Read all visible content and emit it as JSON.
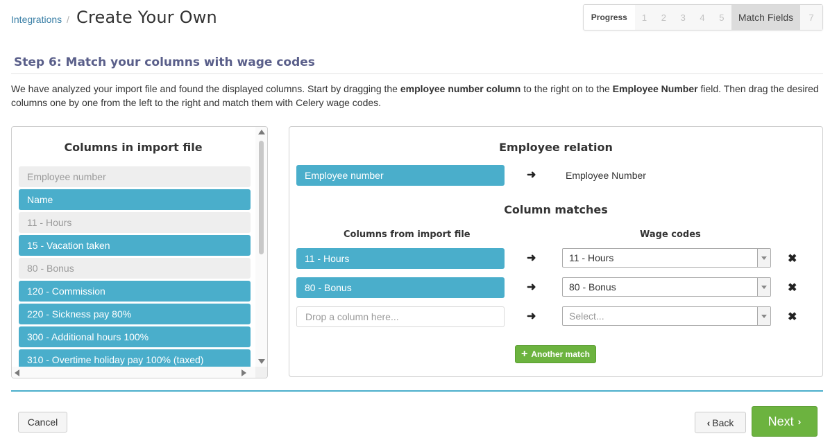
{
  "breadcrumb": {
    "parent": "Integrations",
    "separator": "/"
  },
  "page_title": "Create Your Own",
  "progress": {
    "label": "Progress",
    "steps": [
      "1",
      "2",
      "3",
      "4",
      "5"
    ],
    "active_label": "Match Fields",
    "last_step": "7"
  },
  "step_title": "Step 6: Match your columns with wage codes",
  "intro": {
    "part1": "We have analyzed your import file and found the displayed columns. Start by dragging the ",
    "bold1": "employee number column",
    "part2": " to the right on to the ",
    "bold2": "Employee Number",
    "part3": " field. Then drag the desired columns one by one from the left to the right and match them with Celery wage codes."
  },
  "left_panel": {
    "heading": "Columns in import file",
    "items": [
      {
        "label": "Employee number",
        "state": "used"
      },
      {
        "label": "Name",
        "state": "available"
      },
      {
        "label": "11 - Hours",
        "state": "used"
      },
      {
        "label": "15 - Vacation taken",
        "state": "available"
      },
      {
        "label": "80 - Bonus",
        "state": "used"
      },
      {
        "label": "120 - Commission",
        "state": "available"
      },
      {
        "label": "220 - Sickness pay 80%",
        "state": "available"
      },
      {
        "label": "300 - Additional hours 100%",
        "state": "available"
      },
      {
        "label": "310 - Overtime holiday pay 100% (taxed)",
        "state": "available"
      }
    ]
  },
  "right_panel": {
    "relation_heading": "Employee relation",
    "relation_column": "Employee number",
    "relation_target": "Employee Number",
    "matches_heading": "Column matches",
    "col_header_left": "Columns from import file",
    "col_header_right": "Wage codes",
    "matches": [
      {
        "column": "11 - Hours",
        "wage_code": "11 - Hours"
      },
      {
        "column": "80 - Bonus",
        "wage_code": "80 - Bonus"
      }
    ],
    "drop_placeholder": "Drop a column here...",
    "select_placeholder": "Select...",
    "add_button": "Another match"
  },
  "footer": {
    "cancel": "Cancel",
    "back": "Back",
    "next": "Next"
  },
  "colors": {
    "accent": "#4aaecb",
    "green": "#6cb33f",
    "step_title": "#5a5f8a"
  }
}
